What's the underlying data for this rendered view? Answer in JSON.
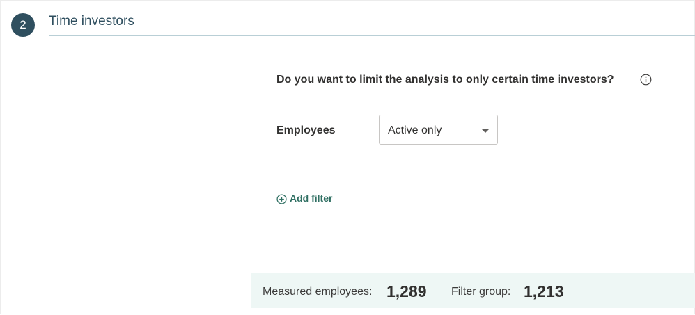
{
  "step": {
    "number": "2",
    "title": "Time investors"
  },
  "question": {
    "text": "Do you want to limit the analysis to only certain time investors?",
    "icon": "info-circle-icon"
  },
  "employees": {
    "label": "Employees",
    "selected": "Active only"
  },
  "add_filter": {
    "label": "Add filter",
    "icon": "plus-circle-icon"
  },
  "summary": {
    "measured_label": "Measured employees:",
    "measured_value": "1,289",
    "filter_label": "Filter group:",
    "filter_value": "1,213"
  },
  "colors": {
    "step_accent": "#2f4f5f",
    "link": "#2f6f62",
    "summary_bg": "#eef7f5"
  }
}
